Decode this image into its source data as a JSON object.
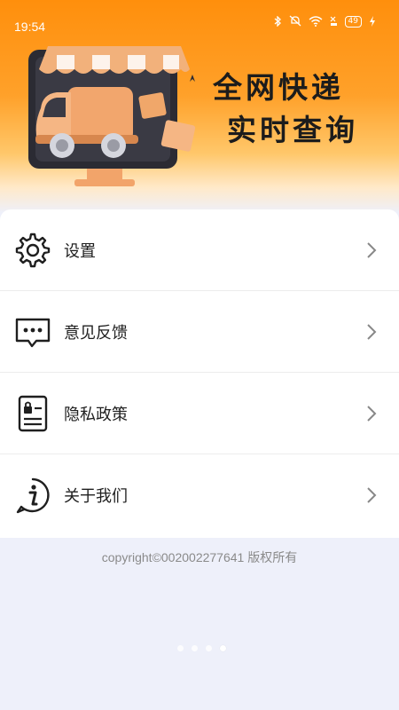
{
  "status_bar": {
    "time": "19:54",
    "battery": "49"
  },
  "banner": {
    "line1": "全网快递",
    "line2": "实时查询"
  },
  "menu": {
    "items": [
      {
        "label": "设置",
        "icon": "gear-icon"
      },
      {
        "label": "意见反馈",
        "icon": "chat-bubble-icon"
      },
      {
        "label": "隐私政策",
        "icon": "privacy-document-icon"
      },
      {
        "label": "关于我们",
        "icon": "info-icon"
      }
    ]
  },
  "footer": {
    "copyright": "copyright©002002277641 版权所有"
  },
  "pager": {
    "count": 4,
    "active_index": 3
  },
  "colors": {
    "accent": "#ff8f0c",
    "text": "#1f1f1f",
    "muted": "#8a8a8a",
    "background": "#eef0fa"
  }
}
